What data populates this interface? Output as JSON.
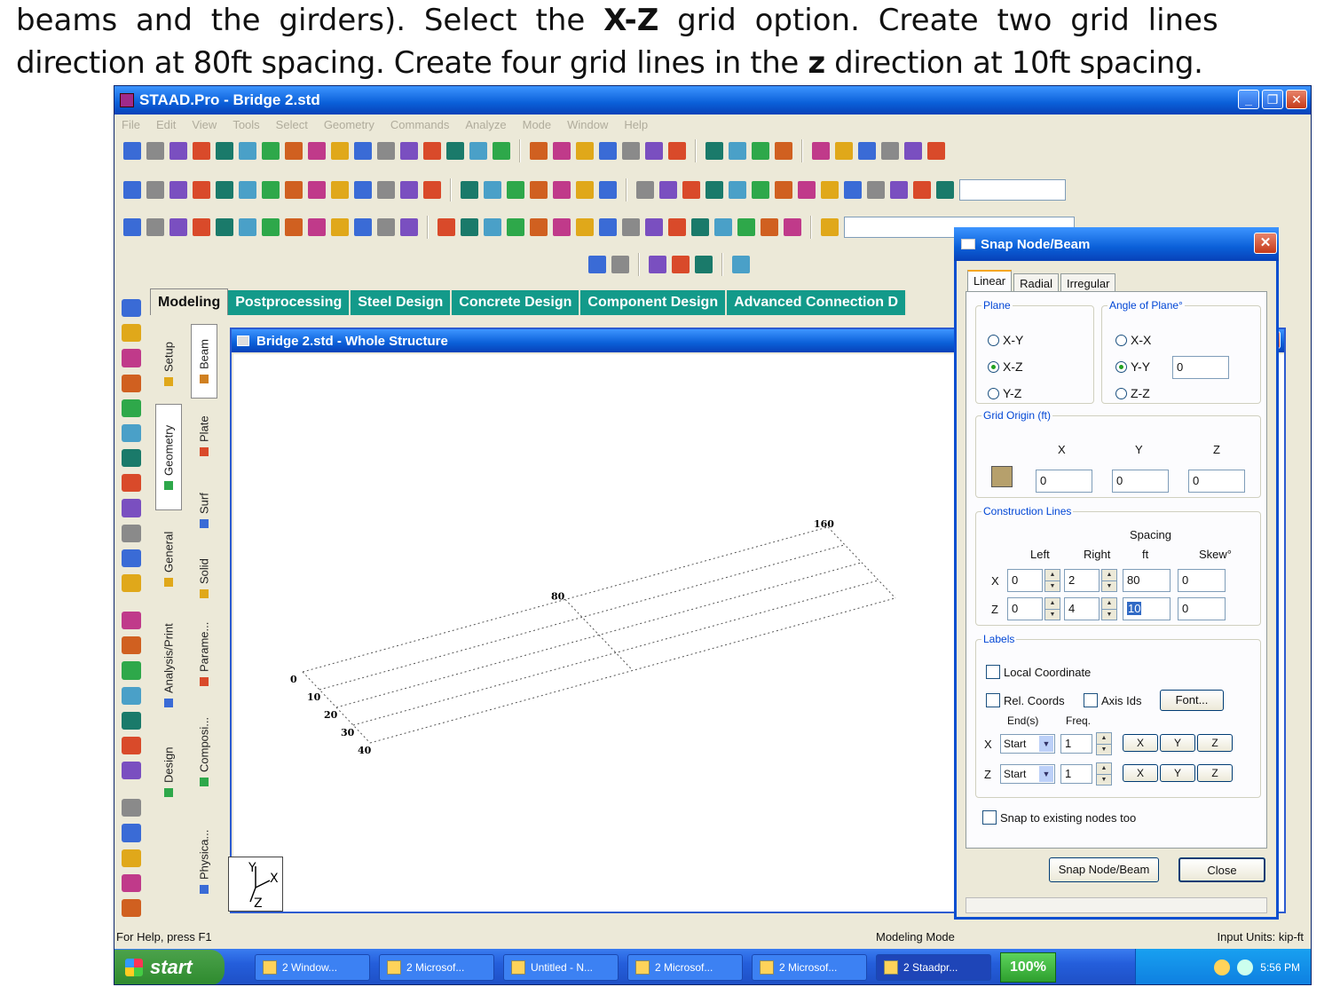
{
  "doc": {
    "line1_a": "beams and the girders).  Select the ",
    "line1_b": "X-Z",
    "line1_c": " grid option.  Create two grid lines",
    "line2_a": "direction at 80ft spacing.  Create four grid lines in the ",
    "line2_b": "z",
    "line2_c": " direction at 10ft spacing."
  },
  "app": {
    "title": "STAAD.Pro - Bridge 2.std",
    "menu": [
      "File",
      "Edit",
      "View",
      "Tools",
      "Select",
      "Geometry",
      "Commands",
      "Analyze",
      "Mode",
      "Window",
      "Help"
    ]
  },
  "tabs": [
    "Modeling",
    "Postprocessing",
    "Steel Design",
    "Concrete Design",
    "Component Design",
    "Advanced Connection D"
  ],
  "vtabs_outer": [
    "Setup",
    "Geometry",
    "General",
    "Analysis/Print",
    "Design"
  ],
  "vtabs_inner": [
    "Beam",
    "Plate",
    "Surf",
    "Solid",
    "Parame...",
    "Composi...",
    "Physica..."
  ],
  "inner_window": {
    "title": "Bridge 2.std - Whole Structure",
    "x_labels": [
      "0",
      "80",
      "160"
    ],
    "z_labels": [
      "0",
      "10",
      "20",
      "30",
      "40"
    ],
    "axis_y": "Y",
    "axis_x": "X",
    "axis_z": "Z"
  },
  "dialog": {
    "title": "Snap Node/Beam",
    "tabs": [
      "Linear",
      "Radial",
      "Irregular"
    ],
    "plane": {
      "legend": "Plane",
      "options": [
        "X-Y",
        "X-Z",
        "Y-Z"
      ],
      "selected": "X-Z"
    },
    "angle": {
      "legend": "Angle of Plane°",
      "options": [
        "X-X",
        "Y-Y",
        "Z-Z"
      ],
      "selected": "Y-Y",
      "value": "0"
    },
    "origin": {
      "legend": "Grid Origin (ft)",
      "x_label": "X",
      "y_label": "Y",
      "z_label": "Z",
      "x": "0",
      "y": "0",
      "z": "0"
    },
    "lines": {
      "legend": "Construction Lines",
      "col_left": "Left",
      "col_right": "Right",
      "col_spacing": "Spacing",
      "col_spacing_unit": "ft",
      "col_skew": "Skew°",
      "row_x": {
        "axis": "X",
        "left": "0",
        "right": "2",
        "spacing": "80",
        "skew": "0"
      },
      "row_z": {
        "axis": "Z",
        "left": "0",
        "right": "4",
        "spacing": "10",
        "skew": "0"
      }
    },
    "labels": {
      "legend": "Labels",
      "local_coord": "Local Coordinate",
      "rel_coords": "Rel. Coords",
      "axis_ids": "Axis Ids",
      "font_btn": "Font...",
      "ends_label": "End(s)",
      "freq_label": "Freq.",
      "row_x": {
        "axis": "X",
        "end": "Start",
        "freq": "1"
      },
      "row_z": {
        "axis": "Z",
        "end": "Start",
        "freq": "1"
      },
      "xyz": [
        "X",
        "Y",
        "Z"
      ]
    },
    "snap_existing": "Snap to existing nodes too",
    "snap_btn": "Snap Node/Beam",
    "close_btn": "Close"
  },
  "status": {
    "help": "For Help, press F1",
    "mode": "Modeling Mode",
    "units": "Input Units:   kip-ft"
  },
  "taskbar": {
    "start": "start",
    "tasks": [
      "2 Window...",
      "2 Microsof...",
      "Untitled - N...",
      "2 Microsof...",
      "2 Microsof...",
      "2 Staadpr..."
    ],
    "zoom": "100%",
    "time": "5:56 PM"
  },
  "colors": {
    "title_blue": "#0a5fd8",
    "tab_teal": "#139a8a",
    "radio_green": "#21a121",
    "taskbar_blue": "#245edb",
    "start_green": "#2e8a2e"
  }
}
